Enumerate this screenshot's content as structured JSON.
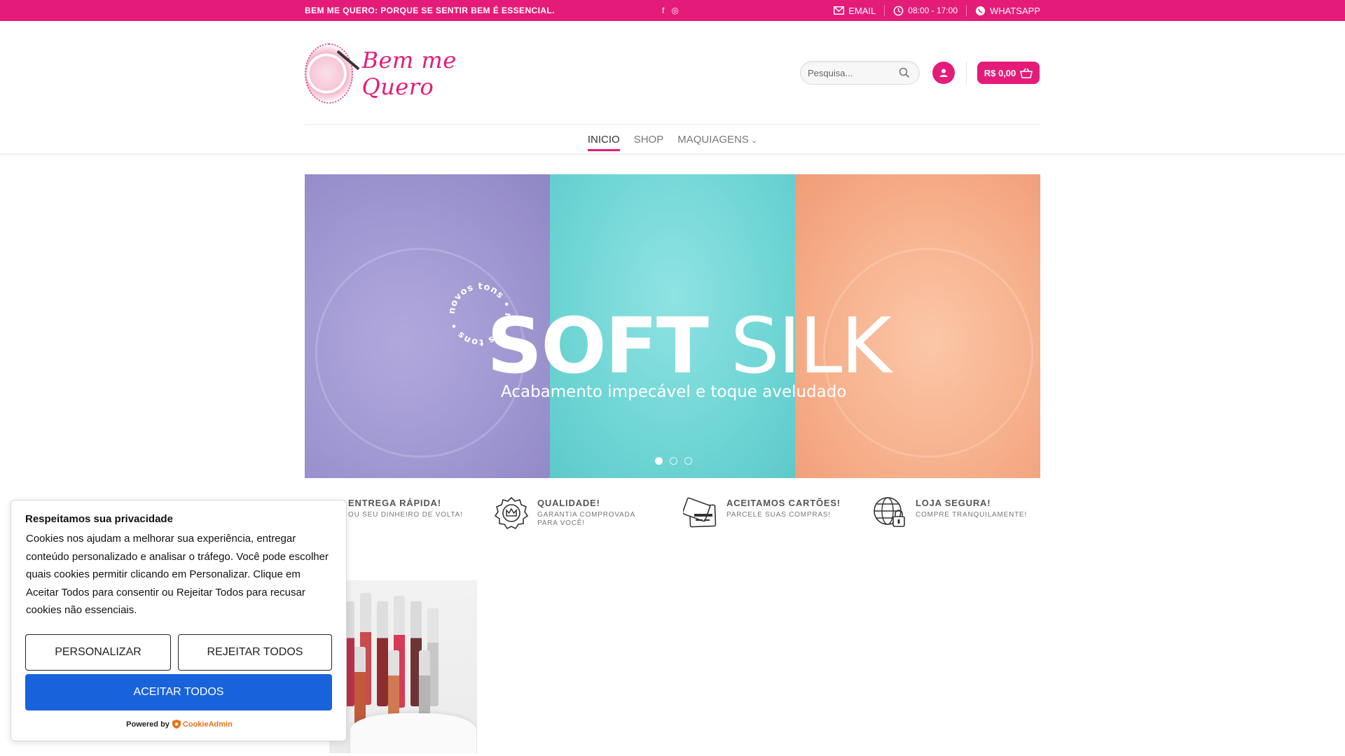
{
  "topbar": {
    "tagline": "BEM ME QUERO: PORQUE SE SENTIR BEM É ESSENCIAL.",
    "social": [
      {
        "icon": "facebook-icon",
        "glyph": "f"
      },
      {
        "icon": "instagram-icon",
        "glyph": "◎"
      }
    ],
    "email_label": "EMAIL",
    "hours_label": "08:00 - 17:00",
    "whatsapp_label": "WHATSAPP"
  },
  "header": {
    "logo_text": "Bem me Quero",
    "search": {
      "placeholder": "Pesquisa..."
    },
    "cart_label": "R$ 0,00"
  },
  "nav": {
    "items": [
      {
        "label": "INICIO",
        "active": true
      },
      {
        "label": "SHOP",
        "active": false
      },
      {
        "label": "MAQUIAGENS",
        "active": false,
        "has_dropdown": true
      }
    ]
  },
  "banner": {
    "badge_text": "novos tons • novos tons •",
    "title_bold": "SOFT",
    "title_light": " SILK",
    "subtitle": "Acabamento impecável e toque aveludado",
    "slides": 3,
    "active_slide": 1,
    "colors": [
      "#9f97d1",
      "#6fd5d5",
      "#f6ae89"
    ]
  },
  "features": [
    {
      "icon": "truck-icon",
      "title": "ENTREGA RÁPIDA!",
      "subtitle": "OU SEU DINHEIRO DE VOLTA!"
    },
    {
      "icon": "quality-badge-icon",
      "title": "QUALIDADE!",
      "subtitle": "GARANTIA COMPROVADA PARA VOCÊ!"
    },
    {
      "icon": "credit-card-icon",
      "title": "ACEITAMOS CARTÕES!",
      "subtitle": "PARCELE SUAS COMPRAS!"
    },
    {
      "icon": "secure-globe-icon",
      "title": "LOJA SEGURA!",
      "subtitle": "COMPRE TRANQUILAMENTE!"
    }
  ],
  "cookie": {
    "title": "Respeitamos sua privacidade",
    "body": "Cookies nos ajudam a melhorar sua experiência, entregar conteúdo personalizado e analisar o tráfego. Você pode escolher quais cookies permitir clicando em Personalizar. Clique em Aceitar Todos para consentir ou Rejeitar Todos para recusar cookies não essenciais.",
    "customize_label": "PERSONALIZAR",
    "reject_label": "REJEITAR TODOS",
    "accept_label": "ACEITAR TODOS",
    "powered_by": "Powered by",
    "brand": "CookieAdmin"
  },
  "colors": {
    "brand": "#e51b79",
    "accept": "#1863dc"
  }
}
